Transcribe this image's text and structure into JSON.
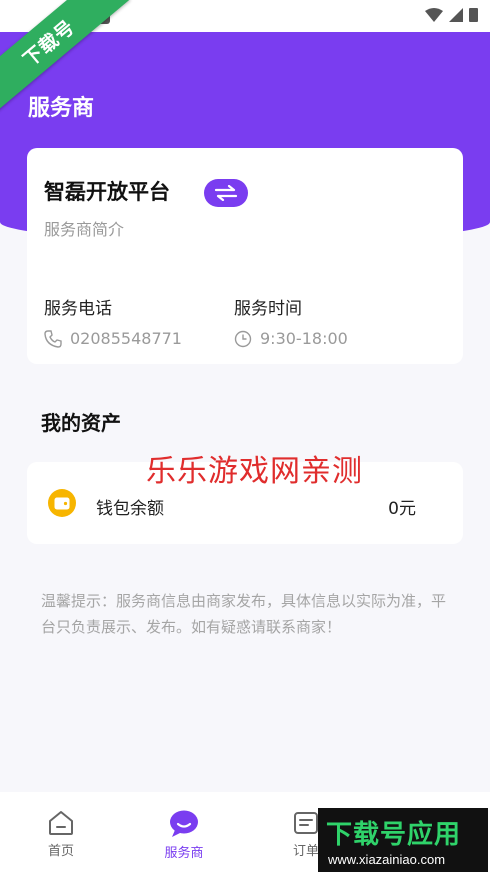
{
  "colors": {
    "primary": "#7a3df0",
    "wallet": "#f7b500",
    "watermark": "#e02d2d",
    "ribbon": "#2fae5f"
  },
  "overlay": {
    "ribbon_text": "下载号",
    "watermark": "乐乐游戏网亲测",
    "banner_title": "下载号应用",
    "banner_url": "www.xiazainiao.com"
  },
  "header": {
    "title": "服务商"
  },
  "merchant": {
    "name": "智磊开放平台",
    "subtitle": "服务商简介",
    "phone_label": "服务电话",
    "phone_value": "02085548771",
    "hours_label": "服务时间",
    "hours_value": "9:30-18:00"
  },
  "assets": {
    "title": "我的资产",
    "wallet_label": "钱包余额",
    "wallet_value": "0元"
  },
  "tip": "温馨提示：服务商信息由商家发布，具体信息以实际为准，平台只负责展示、发布。如有疑惑请联系商家！",
  "tabs": [
    {
      "label": "首页",
      "icon": "home-icon"
    },
    {
      "label": "服务商",
      "icon": "chat-bubble-icon"
    },
    {
      "label": "订单",
      "icon": "order-icon"
    }
  ]
}
